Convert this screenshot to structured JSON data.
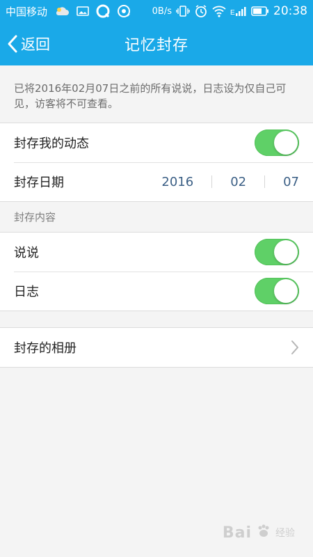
{
  "status_bar": {
    "carrier": "中国移动",
    "net_speed": "0B/s",
    "time": "20:38",
    "signal_label": "E",
    "icons": [
      "cloud-weather-icon",
      "gallery-icon",
      "qq-browser-icon",
      "music-icon",
      "vibrate-icon",
      "alarm-icon",
      "wifi-icon",
      "signal-icon",
      "battery-icon"
    ]
  },
  "header": {
    "back_label": "返回",
    "title": "记忆封存"
  },
  "notice": {
    "text": "已将2016年02月07日之前的所有说说，日志设为仅自己可见，访客将不可查看。"
  },
  "settings": {
    "seal_activity_label": "封存我的动态",
    "seal_activity_on": true,
    "seal_date_label": "封存日期",
    "seal_date": {
      "year": "2016",
      "month": "02",
      "day": "07"
    }
  },
  "content_section": {
    "label": "封存内容",
    "items": [
      {
        "label": "说说",
        "on": true
      },
      {
        "label": "日志",
        "on": true
      }
    ]
  },
  "album": {
    "label": "封存的相册"
  },
  "watermark": {
    "text": "Bai",
    "sub": "经验"
  },
  "colors": {
    "accent": "#1aa9e8",
    "toggle_on": "#5fd067",
    "date_text": "#3b5f85",
    "background": "#f4f4f4"
  }
}
